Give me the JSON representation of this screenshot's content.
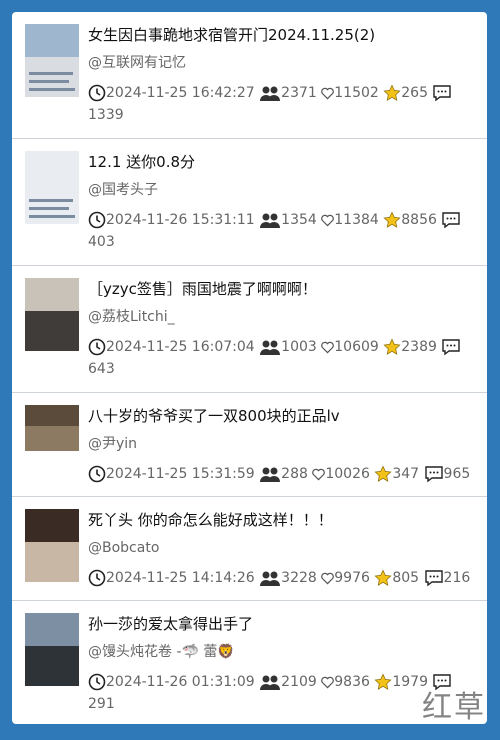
{
  "items": [
    {
      "title": "女生因白事跪地求宿管开门2024.11.25(2)",
      "author": "@互联网有记忆",
      "time": "2024-11-25 16:42:27",
      "viewers": "2371",
      "likes": "11502",
      "stars": "265",
      "comments": "1339"
    },
    {
      "title": "12.1 送你0.8分",
      "author": "@国考头子",
      "time": "2024-11-26 15:31:11",
      "viewers": "1354",
      "likes": "11384",
      "stars": "8856",
      "comments": "403"
    },
    {
      "title": "［yzyc签售］雨国地震了啊啊啊！",
      "author": "@荔枝Litchi_",
      "time": "2024-11-25 16:07:04",
      "viewers": "1003",
      "likes": "10609",
      "stars": "2389",
      "comments": "643"
    },
    {
      "title": "八十岁的爷爷买了一双800块的正品lv",
      "author": "@尹yin",
      "time": "2024-11-25 15:31:59",
      "viewers": "288",
      "likes": "10026",
      "stars": "347",
      "comments": "965"
    },
    {
      "title": "死丫头 你的命怎么能好成这样！！！",
      "author": "@Bobcato",
      "time": "2024-11-25 14:14:26",
      "viewers": "3228",
      "likes": "9976",
      "stars": "805",
      "comments": "216"
    },
    {
      "title": "孙一莎的爱太拿得出手了",
      "author": "@馒头炖花卷 -🦈 蕾🦁",
      "time": "2024-11-26 01:31:09",
      "viewers": "2109",
      "likes": "9836",
      "stars": "1979",
      "comments": "291"
    }
  ],
  "icons": {
    "clock": "clock-icon",
    "viewers": "people-icon",
    "likes": "heart-icon",
    "stars": "star-icon",
    "comments": "comment-icon"
  },
  "colors": {
    "background": "#2f79b9",
    "star": "#f2c21a",
    "text": "#111111",
    "muted": "#666666"
  },
  "watermark": "红草"
}
